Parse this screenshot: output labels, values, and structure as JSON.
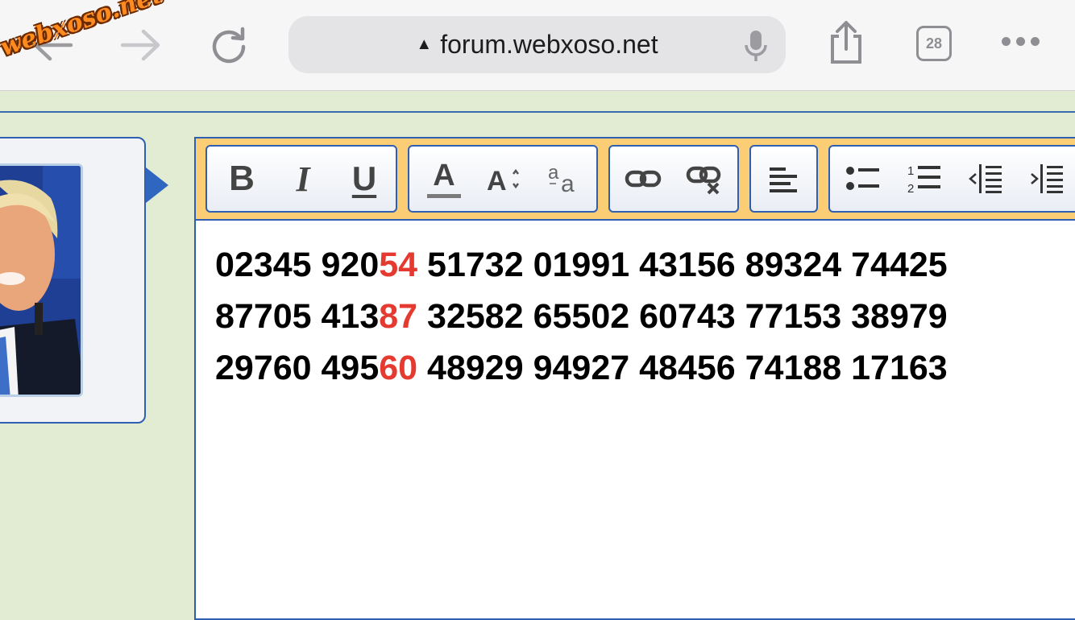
{
  "browser": {
    "url": "forum.webxoso.net",
    "tab_count": "28",
    "icons": [
      "back-arrow-icon",
      "forward-arrow-icon",
      "reload-icon",
      "warning-icon",
      "microphone-icon",
      "share-icon",
      "tabs-icon",
      "more-icon"
    ]
  },
  "watermark": {
    "text": "webxoso.net",
    "color": "#ff8a1e"
  },
  "editor": {
    "toolbar_groups": [
      [
        "bold",
        "italic",
        "underline"
      ],
      [
        "text-color",
        "font-size",
        "font-family"
      ],
      [
        "link",
        "unlink"
      ],
      [
        "align-left"
      ],
      [
        "bullet-list",
        "numbered-list",
        "outdent",
        "indent"
      ]
    ],
    "toolbar_labels": {
      "bold": "B",
      "italic": "I",
      "underline": "U",
      "text_color": "A"
    },
    "lines": [
      [
        {
          "text": "02345 920",
          "highlight": false
        },
        {
          "text": "54",
          "highlight": true
        },
        {
          "text": " 51732 01991 43156 89324 74425",
          "highlight": false
        }
      ],
      [
        {
          "text": "87705 413",
          "highlight": false
        },
        {
          "text": "87",
          "highlight": true
        },
        {
          "text": " 32582 65502 60743 77153 38979",
          "highlight": false
        }
      ],
      [
        {
          "text": "29760 495",
          "highlight": false
        },
        {
          "text": "60",
          "highlight": true
        },
        {
          "text": " 48929 94927 48456 74188 17163",
          "highlight": false
        }
      ]
    ],
    "highlight_color": "#e53a30"
  }
}
